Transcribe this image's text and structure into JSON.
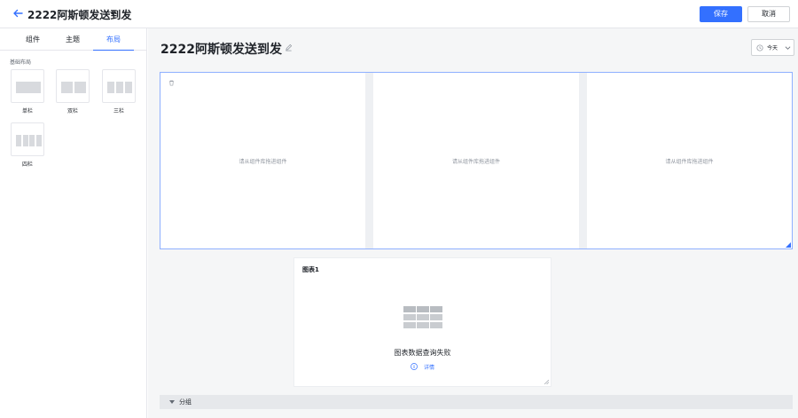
{
  "header": {
    "title": "2222阿斯顿发送到发",
    "save_label": "保存",
    "cancel_label": "取消"
  },
  "left_panel": {
    "tabs": [
      {
        "label": "组件",
        "active": false
      },
      {
        "label": "主题",
        "active": false
      },
      {
        "label": "布局",
        "active": true
      }
    ],
    "section_label": "基础布局",
    "layouts": [
      {
        "label": "单栏",
        "columns": 1
      },
      {
        "label": "双栏",
        "columns": 2
      },
      {
        "label": "三栏",
        "columns": 3
      },
      {
        "label": "四栏",
        "columns": 4
      }
    ]
  },
  "main": {
    "page_title": "2222阿斯顿发送到发",
    "date_filter": {
      "label": "今天"
    },
    "layout_columns": [
      {
        "placeholder": "请从组件库拖进组件"
      },
      {
        "placeholder": "请从组件库拖进组件"
      },
      {
        "placeholder": "请从组件库拖进组件"
      }
    ],
    "chart_card": {
      "title": "图表1",
      "error": "图表数据查询失败",
      "details_label": "详情"
    },
    "group": {
      "label": "分组"
    }
  },
  "colors": {
    "primary": "#3370ff",
    "layout_border": "#8fb0ff",
    "canvas_bg": "#f5f6f7"
  },
  "icons": [
    "back-arrow-icon",
    "caret-down-icon",
    "edit-icon",
    "clock-icon",
    "chevron-down-icon",
    "table-icon",
    "info-icon",
    "resize-icon"
  ]
}
